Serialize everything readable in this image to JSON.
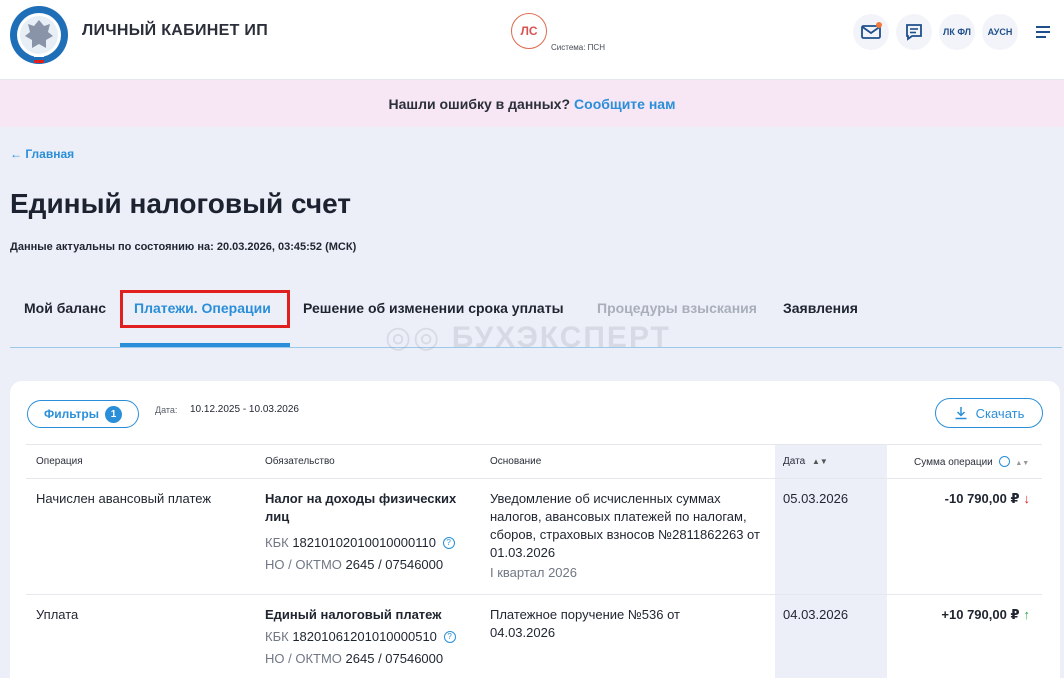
{
  "header": {
    "app_title": "ЛИЧНЫЙ КАБИНЕТ ИП",
    "system_badge": "ЛС",
    "system_label": "Система: ПСН",
    "btn_lk_fl": "ЛК ФЛ",
    "btn_ausn": "АУСН"
  },
  "notice": {
    "text": "Нашли ошибку в данных?",
    "link": "Сообщите нам"
  },
  "breadcrumb": {
    "back": "← Главная"
  },
  "page": {
    "title": "Единый налоговый счет",
    "as_of": "Данные актуальны по состоянию на: 20.03.2026, 03:45:52 (МСК)"
  },
  "tabs": [
    {
      "label": "Мой баланс"
    },
    {
      "label": "Платежи. Операции"
    },
    {
      "label": "Решение об изменении срока уплаты"
    },
    {
      "label": "Процедуры взыскания"
    },
    {
      "label": "Заявления"
    }
  ],
  "watermark": "БУХЭКСПЕРТ",
  "toolbar": {
    "filters_label": "Фильтры",
    "filters_count": "1",
    "date_label": "Дата:",
    "date_value": "10.12.2025 - 10.03.2026",
    "download_label": "Скачать"
  },
  "table": {
    "headers": {
      "operation": "Операция",
      "obligation": "Обязательство",
      "basis": "Основание",
      "date": "Дата",
      "amount": "Сумма операции"
    },
    "rows": [
      {
        "operation": "Начислен авансовый платеж",
        "obligation_title": "Налог на доходы физических лиц",
        "kbk_label": "КБК",
        "kbk": "18210102010010000110",
        "oktmo_label": "НО / ОКТМО",
        "oktmo": "2645 / 07546000",
        "basis": "Уведомление об исчисленных суммах налогов, авансовых платежей по налогам, сборов, страховых взносов №2811862263 от 01.03.2026",
        "period": "I квартал 2026",
        "date": "05.03.2026",
        "amount": "-10 790,00 ₽",
        "direction": "down"
      },
      {
        "operation": "Уплата",
        "obligation_title": "Единый налоговый платеж",
        "kbk_label": "КБК",
        "kbk": "18201061201010000510",
        "oktmo_label": "НО / ОКТМО",
        "oktmo": "2645 / 07546000",
        "basis": "Платежное поручение №536 от 04.03.2026",
        "period": "",
        "date": "04.03.2026",
        "amount": "+10 790,00 ₽",
        "direction": "up"
      }
    ]
  },
  "colors": {
    "accent": "#2a8fd8",
    "highlight": "#e0201f",
    "notice_bg": "#f7e6f4",
    "negative": "#e0201f",
    "positive": "#2aa84a"
  }
}
